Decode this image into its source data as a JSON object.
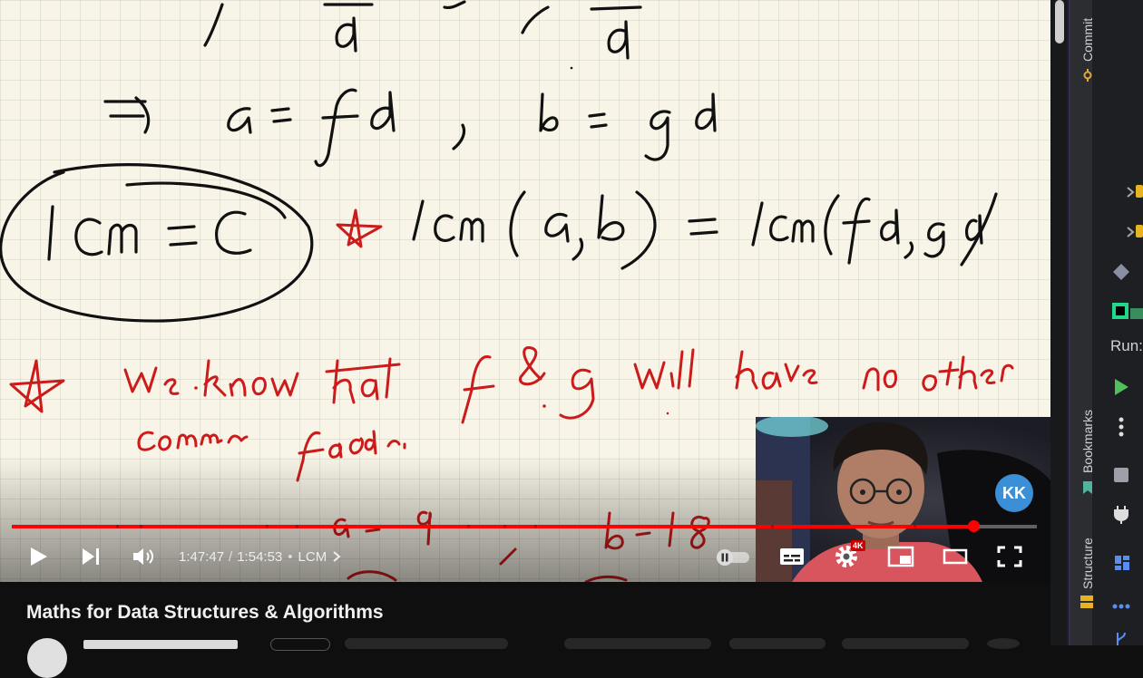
{
  "video": {
    "title": "Maths for Data Structures & Algorithms",
    "current_time": "1:47:47",
    "duration": "1:54:53",
    "time_separator": "/",
    "chapter": "LCM",
    "progress": 0.9381,
    "quality_badge": "4K",
    "channel_logo_text": "KK"
  },
  "controls": {
    "play": "play-icon",
    "next": "next-icon",
    "volume": "volume-icon",
    "autoplay": "autoplay-toggle",
    "subtitles": "subtitles-icon",
    "settings": "settings-icon",
    "miniplayer": "miniplayer-icon",
    "theater": "theater-icon",
    "fullscreen": "fullscreen-icon"
  },
  "ide": {
    "commit_label": "Commit",
    "bookmarks_label": "Bookmarks",
    "structure_label": "Structure",
    "run_label": "Run:"
  },
  "colors": {
    "progress_played": "#ff0000",
    "progress_buffered": "#c9c9c9",
    "ink_black": "#111111",
    "ink_red": "#cc1b1b",
    "ide_background": "#1e1f22"
  }
}
